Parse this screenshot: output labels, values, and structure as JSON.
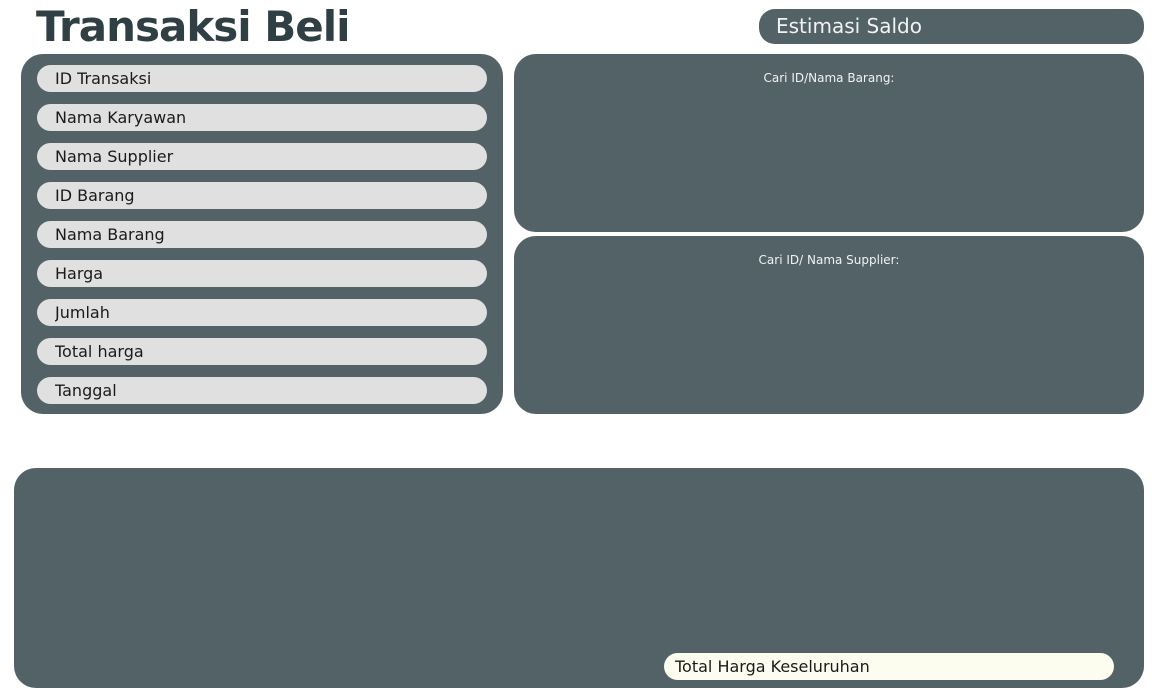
{
  "header": {
    "title": "Transaksi Beli",
    "saldo_label": "Estimasi Saldo"
  },
  "form": {
    "fields": [
      {
        "placeholder": "ID Transaksi"
      },
      {
        "placeholder": "Nama Karyawan"
      },
      {
        "placeholder": "Nama Supplier"
      },
      {
        "placeholder": "ID Barang"
      },
      {
        "placeholder": "Nama Barang"
      },
      {
        "placeholder": "Harga"
      },
      {
        "placeholder": "Jumlah"
      },
      {
        "placeholder": "Total harga"
      },
      {
        "placeholder": "Tanggal"
      }
    ]
  },
  "search": {
    "barang_label": "Cari ID/Nama Barang:",
    "supplier_label": "Cari ID/ Nama Supplier:"
  },
  "table": {
    "total_placeholder": "Total Harga Keseluruhan"
  },
  "colors": {
    "panel": "#526266",
    "title": "#2f3f44",
    "field": "#e0e0e0",
    "total_field": "#fdfdef"
  }
}
